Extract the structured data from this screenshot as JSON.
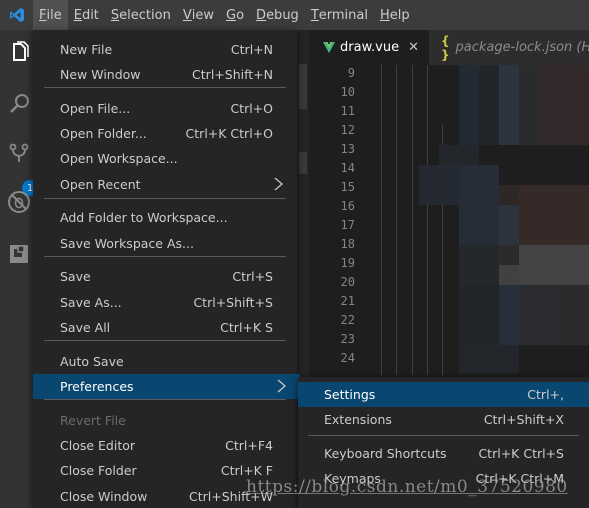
{
  "menubar": {
    "logo": "vscode-logo",
    "items": [
      {
        "label": "File",
        "mnemonic": "F",
        "rest": "ile",
        "active": true
      },
      {
        "label": "Edit",
        "mnemonic": "E",
        "rest": "dit"
      },
      {
        "label": "Selection",
        "mnemonic": "S",
        "rest": "election"
      },
      {
        "label": "View",
        "mnemonic": "V",
        "rest": "iew"
      },
      {
        "label": "Go",
        "mnemonic": "G",
        "rest": "o"
      },
      {
        "label": "Debug",
        "mnemonic": "D",
        "rest": "ebug"
      },
      {
        "label": "Terminal",
        "mnemonic": "T",
        "rest": "erminal"
      },
      {
        "label": "Help",
        "mnemonic": "H",
        "rest": "elp"
      }
    ]
  },
  "activitybar": {
    "icons": [
      "explorer-icon",
      "search-icon",
      "source-control-icon",
      "debug-icon",
      "extensions-icon"
    ],
    "source_control_badge": "1"
  },
  "tabs": [
    {
      "label": "draw.vue",
      "icon": "vue-icon",
      "active": true,
      "close": "✕"
    },
    {
      "label": "package-lock.json (HEA",
      "icon": "json-braces-icon",
      "icon_text": "{ }",
      "active": false
    }
  ],
  "editor": {
    "line_numbers": [
      "9",
      "10",
      "11",
      "12",
      "13",
      "14",
      "15",
      "16",
      "17",
      "18",
      "19",
      "20",
      "21",
      "22",
      "23",
      "24"
    ]
  },
  "file_menu": {
    "groups": [
      [
        {
          "label": "New File",
          "shortcut": "Ctrl+N"
        },
        {
          "label": "New Window",
          "shortcut": "Ctrl+Shift+N"
        }
      ],
      [
        {
          "label": "Open File...",
          "shortcut": "Ctrl+O"
        },
        {
          "label": "Open Folder...",
          "shortcut": "Ctrl+K Ctrl+O"
        },
        {
          "label": "Open Workspace...",
          "shortcut": ""
        },
        {
          "label": "Open Recent",
          "shortcut": "",
          "submenu": true
        }
      ],
      [
        {
          "label": "Add Folder to Workspace...",
          "shortcut": ""
        },
        {
          "label": "Save Workspace As...",
          "shortcut": ""
        }
      ],
      [
        {
          "label": "Save",
          "shortcut": "Ctrl+S"
        },
        {
          "label": "Save As...",
          "shortcut": "Ctrl+Shift+S"
        },
        {
          "label": "Save All",
          "shortcut": "Ctrl+K S"
        }
      ],
      [
        {
          "label": "Auto Save",
          "shortcut": ""
        },
        {
          "label": "Preferences",
          "shortcut": "",
          "submenu": true,
          "selected": true
        }
      ],
      [
        {
          "label": "Revert File",
          "shortcut": "",
          "disabled": true
        },
        {
          "label": "Close Editor",
          "shortcut": "Ctrl+F4"
        },
        {
          "label": "Close Folder",
          "shortcut": "Ctrl+K F"
        },
        {
          "label": "Close Window",
          "shortcut": "Ctrl+Shift+W"
        }
      ]
    ]
  },
  "preferences_menu": {
    "items": [
      {
        "label": "Settings",
        "shortcut": "Ctrl+,",
        "selected": true
      },
      {
        "label": "Extensions",
        "shortcut": "Ctrl+Shift+X"
      },
      {
        "label": "Keyboard Shortcuts",
        "shortcut": "Ctrl+K Ctrl+S"
      },
      {
        "label": "Keymaps",
        "shortcut": "Ctrl+K Ctrl+M"
      }
    ]
  },
  "watermark": "https://blog.csdn.net/m0_37520980",
  "colors": {
    "selection": "#094771",
    "accent": "#007acc",
    "vue_green": "#41b883",
    "json_yellow": "#cbcb41"
  }
}
